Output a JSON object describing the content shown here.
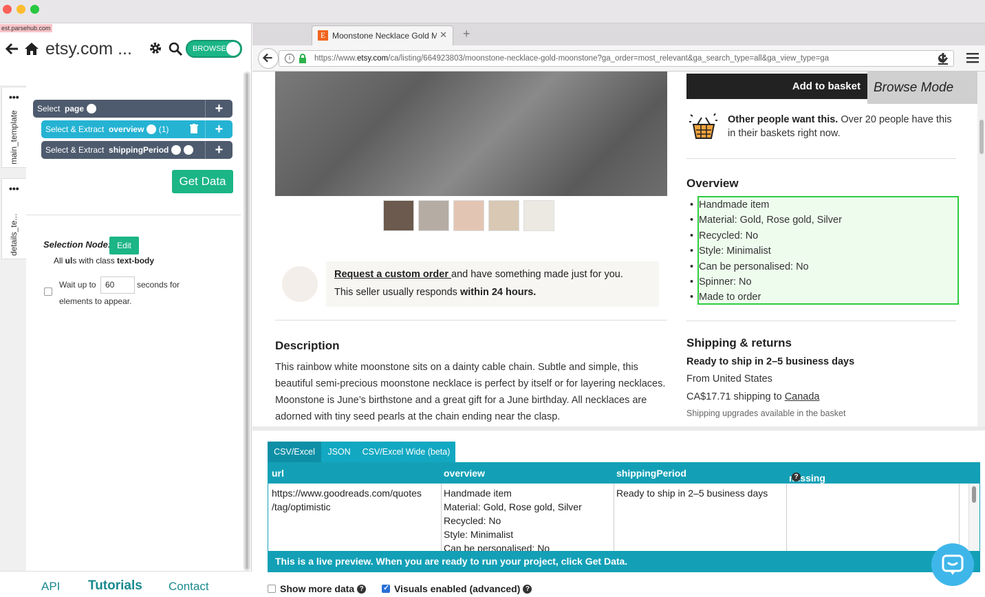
{
  "parsehub": {
    "url_badge": "est.parsehub.com",
    "project_title": "etsy.com ...",
    "browse_toggle": "BROWSE",
    "vertical_tabs": [
      "main_template",
      "details_te..."
    ],
    "commands": [
      {
        "prefix": "Select",
        "target": "page"
      },
      {
        "prefix": "Select & Extract",
        "target": "overview",
        "count": "(1)"
      },
      {
        "prefix": "Select & Extract",
        "target": "shippingPeriod"
      }
    ],
    "get_data_label": "Get Data",
    "selection_node_label": "Selection Node:",
    "edit_label": "Edit",
    "selection_desc_pre": "All ",
    "selection_desc_tag": "ul",
    "selection_desc_mid": "s with class ",
    "selection_desc_class": "text-body",
    "wait_pre": "Wait up to",
    "wait_value": "60",
    "wait_post": "seconds for",
    "wait_post2": "elements to appear.",
    "footer": {
      "api": "API",
      "tutorials": "Tutorials",
      "contact": "Contact"
    }
  },
  "browser": {
    "tab_title": "Moonstone Necklace Gold Mo",
    "favicon_letter": "E",
    "url_prefix": "https://www.",
    "url_host": "etsy.com",
    "url_rest": "/ca/listing/664923803/moonstone-necklace-gold-moonstone?ga_order=most_relevant&ga_search_type=all&ga_view_type=ga"
  },
  "listing": {
    "add_to_basket": "Add to basket",
    "browse_mode": "Browse Mode",
    "others_bold": "Other people want this.",
    "others_rest": " Over 20 people have this in their baskets right now.",
    "overview_heading": "Overview",
    "overview_items": [
      "Handmade item",
      "Material: Gold, Rose gold, Silver",
      "Recycled: No",
      "Style: Minimalist",
      "Can be personalised: No",
      "Spinner: No",
      "Made to order"
    ],
    "custom_link": "Request a custom order ",
    "custom_rest": "and have something made just for you.",
    "responds_pre": "This seller usually responds ",
    "responds_bold": "within 24 hours.",
    "description_heading": "Description",
    "description_text": "This rainbow white moonstone sits on a dainty cable chain. Subtle and simple, this beautiful semi-precious moonstone necklace is perfect by itself or for layering necklaces. Moonstone is June’s birthstone and a great gift for a June birthday. All necklaces are adorned with tiny seed pearls at the chain ending near the clasp.",
    "shipping_heading": "Shipping & returns",
    "ship_ready": "Ready to ship in 2–5 business days",
    "ship_from": "From United States",
    "ship_cost_pre": "CA$17.71 shipping to ",
    "ship_country": "Canada",
    "ship_upgrades": "Shipping upgrades available in the basket"
  },
  "results": {
    "tabs": [
      "CSV/Excel",
      "JSON",
      "CSV/Excel Wide (beta)"
    ],
    "columns": [
      "url",
      "overview",
      "shippingPeriod",
      "missing data"
    ],
    "row": {
      "url": "https://www.goodreads.com/quotes /tag/optimistic",
      "overview_lines": [
        "Handmade item",
        "Material: Gold, Rose gold, Silver",
        "Recycled: No",
        "Style: Minimalist",
        "Can be personalised: No"
      ],
      "shippingPeriod": "Ready to ship in 2–5 business days",
      "missing_data": ""
    },
    "live_preview": "This is a live preview. When you are ready to run your project, click Get Data.",
    "show_more": "Show more data",
    "visuals": "Visuals enabled (advanced)"
  },
  "colors": {
    "parsehub_green": "#1bb586",
    "command_dark": "#4e5b6e",
    "command_active": "#25b3d3",
    "results_teal": "#13a0b6",
    "etsy_orange": "#f1641e",
    "highlight_green": "#2ecc40"
  }
}
